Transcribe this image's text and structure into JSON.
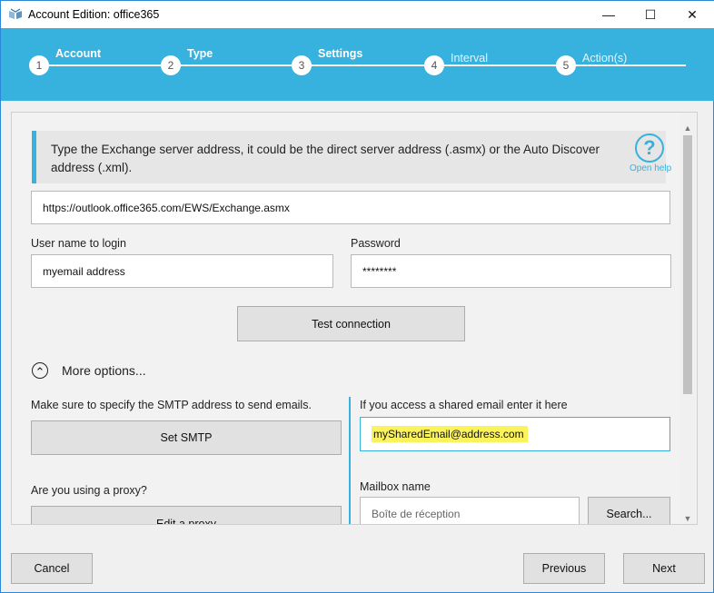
{
  "window": {
    "title": "Account Edition: office365",
    "minimize_glyph": "—",
    "maximize_glyph": "☐",
    "close_glyph": "✕"
  },
  "steps": [
    {
      "number": "1",
      "label": "Account",
      "state": "done"
    },
    {
      "number": "2",
      "label": "Type",
      "state": "done"
    },
    {
      "number": "3",
      "label": "Settings",
      "state": "current"
    },
    {
      "number": "4",
      "label": "Interval",
      "state": "todo"
    },
    {
      "number": "5",
      "label": "Action(s)",
      "state": "todo"
    }
  ],
  "info": {
    "text": "Type the Exchange server address, it could be the direct server address (.asmx) or the Auto Discover address (.xml).",
    "help_glyph": "?",
    "help_label": "Open help"
  },
  "server": {
    "value": "https://outlook.office365.com/EWS/Exchange.asmx"
  },
  "login": {
    "username_label": "User name to login",
    "username_value": "myemail address",
    "password_label": "Password",
    "password_value": "********"
  },
  "test_button": "Test connection",
  "more_options": {
    "label": "More options...",
    "glyph": "⌃"
  },
  "smtp": {
    "hint": "Make sure to specify the SMTP address to send emails.",
    "button": "Set SMTP"
  },
  "shared": {
    "label": "If you access a shared email enter it here",
    "value": "mySharedEmail@address.com"
  },
  "proxy": {
    "question": "Are you using a proxy?",
    "button": "Edit a proxy"
  },
  "mailbox": {
    "label": "Mailbox name",
    "placeholder": "Boîte de réception",
    "search_button": "Search..."
  },
  "footer": {
    "cancel": "Cancel",
    "previous": "Previous",
    "next": "Next"
  },
  "colors": {
    "accent": "#37b1de",
    "highlight": "#fbf35c"
  }
}
